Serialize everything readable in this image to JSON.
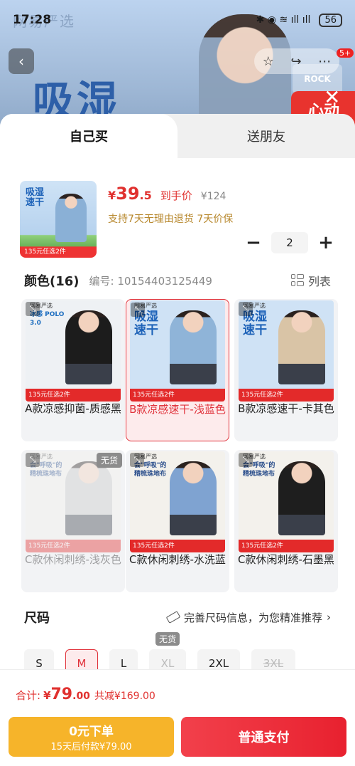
{
  "status_bar": {
    "time": "17:28",
    "battery": "56",
    "icons": "✱ ◉ ≋ ıll ıll"
  },
  "background": {
    "brand_text": "网易严选",
    "headline": "吸湿",
    "logo_text": "ROCK",
    "red_tag": "心动",
    "cart_badge": "5+"
  },
  "tabs": [
    {
      "label": "自己买",
      "active": true
    },
    {
      "label": "送朋友",
      "active": false
    }
  ],
  "summary": {
    "thumb_text": "吸湿速干",
    "thumb_footer": "135元任选2件",
    "price_currency": "¥",
    "price_int": "39",
    "price_dec": ".5",
    "price_tag": "到手价",
    "original_price": "¥124",
    "promise": "支持7天无理由退货 7天价保",
    "quantity": "2",
    "minus": "−",
    "plus": "+"
  },
  "color_section": {
    "title": "颜色(16)",
    "sku": "编号: 10154403125449",
    "view_label": "列表"
  },
  "variants": [
    {
      "label": "A款凉感抑菌-质感黑",
      "hero": "冰感 POLO 3.0",
      "brand": "网易严选",
      "ribbon": "135元任选2件",
      "selected": false,
      "sold_out": false,
      "bg": "#eef1f4",
      "shirt": "#1c1c1c",
      "hero_color": "#1f6fc0"
    },
    {
      "label": "B款凉感速干-浅蓝色",
      "hero": "吸湿 速干",
      "brand": "网易严选",
      "ribbon": "135元任选2件",
      "selected": true,
      "sold_out": false,
      "bg": "#cfe2f5",
      "shirt": "#8fb4d8",
      "hero_color": "#1d62b8"
    },
    {
      "label": "B款凉感速干-卡其色",
      "hero": "吸湿 速干",
      "brand": "网易严选",
      "ribbon": "135元任选2件",
      "selected": false,
      "sold_out": false,
      "bg": "#cfe2f5",
      "shirt": "#d9c4a6",
      "hero_color": "#1d62b8"
    },
    {
      "label": "C款休闲刺绣-浅灰色",
      "hero": "会\"呼吸\"的 精梳珠地布",
      "brand": "网易严选",
      "ribbon": "135元任选2件",
      "selected": false,
      "sold_out": true,
      "sold_tag": "无货",
      "bg": "#f3f1ec",
      "shirt": "#c8c8c8",
      "hero_color": "#2b4f8c"
    },
    {
      "label": "C款休闲刺绣-水洗蓝",
      "hero": "会\"呼吸\"的 精梳珠地布",
      "brand": "网易严选",
      "ribbon": "135元任选2件",
      "selected": false,
      "sold_out": false,
      "bg": "#f3f1ec",
      "shirt": "#7fa3d1",
      "hero_color": "#2b4f8c"
    },
    {
      "label": "C款休闲刺绣-石墨黑",
      "hero": "会\"呼吸\"的 精梳珠地布",
      "brand": "网易严选",
      "ribbon": "135元任选2件",
      "selected": false,
      "sold_out": false,
      "bg": "#f3f1ec",
      "shirt": "#1e1e1e",
      "hero_color": "#2b4f8c"
    }
  ],
  "size_section": {
    "title": "尺码",
    "hint": "完善尺码信息，为您精准推荐",
    "arrow": "›",
    "sizes": [
      {
        "label": "S",
        "state": "normal"
      },
      {
        "label": "M",
        "state": "selected"
      },
      {
        "label": "L",
        "state": "normal"
      },
      {
        "label": "XL",
        "state": "disabled",
        "tag": "无货"
      },
      {
        "label": "2XL",
        "state": "normal"
      },
      {
        "label": "3XL",
        "state": "strike"
      }
    ]
  },
  "footer": {
    "total_label": "合计:",
    "total_currency": "¥",
    "total_int": "79",
    "total_dec": ".00",
    "discount": "共减¥169.00",
    "pay_later_line1": "0元下单",
    "pay_later_line2": "15天后付款¥79.00",
    "pay_label": "普通支付"
  },
  "colors": {
    "accent": "#e0312f",
    "warning": "#f6b42a",
    "promise": "#b8892f"
  }
}
